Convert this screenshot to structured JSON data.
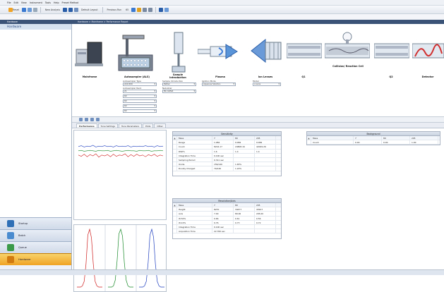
{
  "menu": [
    "File",
    "Edit",
    "View",
    "Instrument",
    "Tools",
    "Help",
    "Preset Method"
  ],
  "toolbar": {
    "items": [
      "Reset",
      "New Analysis",
      "Default Layout",
      "Previous Run"
    ],
    "zoom": "65"
  },
  "nav": {
    "section": "Hardware",
    "breadcrumb": "Hardware > Mainframe > Performance Report"
  },
  "sidebar": {
    "title": "Hardware",
    "buttons": [
      {
        "label": "Startup",
        "icon": "startup-icon",
        "color": "#2f6fb6"
      },
      {
        "label": "Batch",
        "icon": "batch-icon",
        "color": "#4a8bd0"
      },
      {
        "label": "Queue",
        "icon": "queue-icon",
        "color": "#3a9a4a"
      },
      {
        "label": "Hardware",
        "icon": "hardware-icon",
        "color": "#d07a10"
      }
    ]
  },
  "flow": {
    "components": [
      "Mainframe",
      "Autosampler (ALS)",
      "Sample Introduction",
      "Plasma",
      "Ion Lenses",
      "Q1",
      "Collision/ Reaction Cell",
      "Q2",
      "Detector"
    ],
    "fields": [
      {
        "label": "Autosampler Type",
        "value": "ASX-500"
      },
      {
        "label": "Autosampler Rack",
        "value": "21"
      },
      {
        "label": "",
        "value": "60"
      },
      {
        "label": "",
        "value": "60"
      },
      {
        "label": "",
        "value": "60"
      },
      {
        "label": "",
        "value": "60"
      }
    ],
    "intro": [
      {
        "label": "Sample Introduction",
        "value": "Peltier"
      },
      {
        "label": "Nebulizer",
        "value": "MicroMist"
      }
    ],
    "plasma": {
      "label": "Ignition Mode",
      "value": "Aqueous Solution"
    },
    "lens": {
      "label": "Model",
      "value": "x-Lens"
    }
  },
  "tabs": [
    "Performance",
    "Tune Settings",
    "Tune Parameters",
    "Plots",
    "Other"
  ],
  "chart_data": [
    {
      "type": "line",
      "series": [
        {
          "color": "#1f3fbf",
          "values": [
            0.72,
            0.74,
            0.71,
            0.73,
            0.72,
            0.75,
            0.71,
            0.73,
            0.72,
            0.74,
            0.72,
            0.73,
            0.71,
            0.74,
            0.72,
            0.73,
            0.72,
            0.74,
            0.71,
            0.73,
            0.72,
            0.73,
            0.72,
            0.74,
            0.72,
            0.73,
            0.71,
            0.74,
            0.72,
            0.73
          ]
        },
        {
          "color": "#d02020",
          "values": [
            0.52,
            0.49,
            0.54,
            0.48,
            0.53,
            0.5,
            0.55,
            0.47,
            0.52,
            0.5,
            0.53,
            0.48,
            0.54,
            0.49,
            0.52,
            0.51,
            0.55,
            0.48,
            0.53,
            0.49,
            0.54,
            0.5,
            0.52,
            0.48,
            0.53,
            0.5,
            0.54,
            0.49,
            0.52,
            0.5
          ]
        },
        {
          "color": "#1a8a2a",
          "values": [
            0.62,
            0.63,
            0.61,
            0.62,
            0.63,
            0.62,
            0.61,
            0.63,
            0.62,
            0.62,
            0.63,
            0.61,
            0.62,
            0.63,
            0.62,
            0.61,
            0.62,
            0.63,
            0.62,
            0.62,
            0.61,
            0.63,
            0.62,
            0.62,
            0.63,
            0.61,
            0.62,
            0.62,
            0.63,
            0.62
          ]
        }
      ]
    },
    {
      "type": "line",
      "series": [
        {
          "color": "#d02020",
          "values": [
            0,
            0,
            0,
            0.02,
            0.1,
            0.4,
            0.9,
            1,
            0.85,
            0.4,
            0.1,
            0.02,
            0,
            0,
            0
          ]
        },
        {
          "color": "#1a8a2a",
          "values": [
            0,
            0,
            0,
            0.02,
            0.12,
            0.45,
            0.92,
            1,
            0.88,
            0.42,
            0.12,
            0.02,
            0,
            0,
            0
          ]
        },
        {
          "color": "#1f3fbf",
          "values": [
            0,
            0,
            0,
            0.02,
            0.1,
            0.42,
            0.9,
            1,
            0.86,
            0.4,
            0.1,
            0.02,
            0,
            0,
            0
          ]
        }
      ]
    }
  ],
  "sens": {
    "title": "Sensitivity",
    "cols": [
      "Mass",
      "7",
      "89",
      "205"
    ],
    "rows": [
      [
        "Range",
        "1.084",
        "9.084",
        "9.084"
      ],
      [
        "Count",
        "8216.17",
        "24808.16",
        "42049.26"
      ],
      [
        "RSD%",
        "1.6",
        "1.4",
        "1.4"
      ],
      [
        "Integration Time",
        "0.100 sec",
        "",
        ""
      ],
      [
        "Sampling Period",
        "0.311 sec",
        "",
        ""
      ],
      [
        "Oxide",
        "156/140",
        "1.65%",
        ""
      ],
      [
        "Doubly Charged",
        "70/140",
        "1.22%",
        ""
      ]
    ]
  },
  "bg": {
    "title": "Background",
    "cols": [
      "Mass",
      "7",
      "89",
      "205"
    ],
    "rows": [
      [
        "Count",
        "0.00",
        "0.00",
        "1.00"
      ]
    ]
  },
  "res": {
    "title": "Resolution/Axis",
    "cols": [
      "Mass",
      "7",
      "89",
      "205"
    ],
    "rows": [
      [
        "Height",
        "8270",
        "34477",
        "43917"
      ],
      [
        "Axis",
        "7.00",
        "89.00",
        "205.00"
      ],
      [
        "W-50%",
        "0.66",
        "0.61",
        "0.56"
      ],
      [
        "W-10%",
        "0.76",
        "0.73",
        "0.72"
      ],
      [
        "Integration Time",
        "0.100 sec",
        "",
        ""
      ],
      [
        "Acquisition Time",
        "22.760 sec",
        "",
        ""
      ]
    ]
  }
}
